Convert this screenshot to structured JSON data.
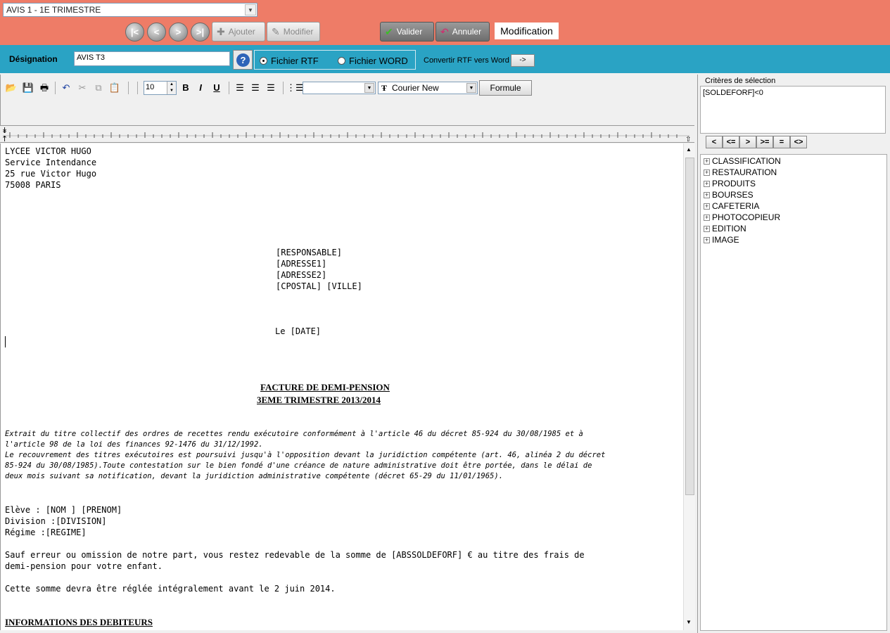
{
  "topbar": {
    "record_select": "AVIS 1 - 1E TRIMESTRE",
    "nav": {
      "first": "|<",
      "prev": "<",
      "next": ">",
      "last": ">|"
    },
    "add_label": "Ajouter",
    "edit_label": "Modifier",
    "validate_label": "Valider",
    "cancel_label": "Annuler",
    "mode_label": "Modification"
  },
  "designation": {
    "label": "Désignation",
    "value": "AVIS T3",
    "help": "?",
    "rtf_label": "Fichier RTF",
    "word_label": "Fichier WORD",
    "selected_format": "rtf",
    "convert_label": "Convertir RTF vers Word",
    "convert_btn": "->"
  },
  "toolbar": {
    "font_size": "10",
    "bold": "B",
    "italic": "I",
    "underline": "U",
    "paragraph_style": "",
    "font_name": "Courier New",
    "formule_label": "Formule"
  },
  "document": {
    "addr1": "LYCEE VICTOR HUGO",
    "addr2": "Service Intendance",
    "addr3": "25 rue Victor Hugo",
    "addr4": "75008 PARIS",
    "resp1": "[RESPONSABLE]",
    "resp2": "[ADRESSE1]",
    "resp3": "[ADRESSE2]",
    "resp4": "[CPOSTAL] [VILLE]",
    "date_line": "Le [DATE]",
    "title1": "FACTURE DE DEMI-PENSION",
    "title2": "3EME TRIMESTRE 2013/2014",
    "legal1": "Extrait du titre collectif des ordres de recettes rendu exécutoire conformément à l'article 46 du décret 85-924 du 30/08/1985 et à",
    "legal2": "l'article 98 de la loi des finances 92-1476 du 31/12/1992.",
    "legal3": "Le recouvrement des titres exécutoires est poursuivi jusqu'à l'opposition devant la juridiction compétente (art. 46, alinéa 2 du décret",
    "legal4": "85-924 du 30/08/1985).Toute contestation sur le bien fondé d'une créance de nature administrative doit être portée, dans le délai de",
    "legal5": "deux mois suivant sa notification, devant la juridiction administrative compétente (décret 65-29 du 11/01/1965).",
    "student": "Elève : [NOM ] [PRENOM]",
    "division": "Division :[DIVISION]",
    "regime": "Régime :[REGIME]",
    "body1": "Sauf erreur ou omission de notre part, vous restez redevable de la somme de [ABSSOLDEFORF] € au titre des frais de",
    "body2": "demi-pension pour votre enfant.",
    "body3": "Cette somme devra être réglée intégralement avant le 2 juin 2014.",
    "section": "INFORMATIONS DES DEBITEURS"
  },
  "criteria": {
    "legend": "Critères de sélection",
    "value": "[SOLDEFORF]<0",
    "ops": [
      "<",
      "<=",
      ">",
      ">=",
      "=",
      "<>"
    ]
  },
  "tree": [
    "CLASSIFICATION",
    "RESTAURATION",
    "PRODUITS",
    "BOURSES",
    "CAFETERIA",
    "PHOTOCOPIEUR",
    "EDITION",
    "IMAGE"
  ]
}
